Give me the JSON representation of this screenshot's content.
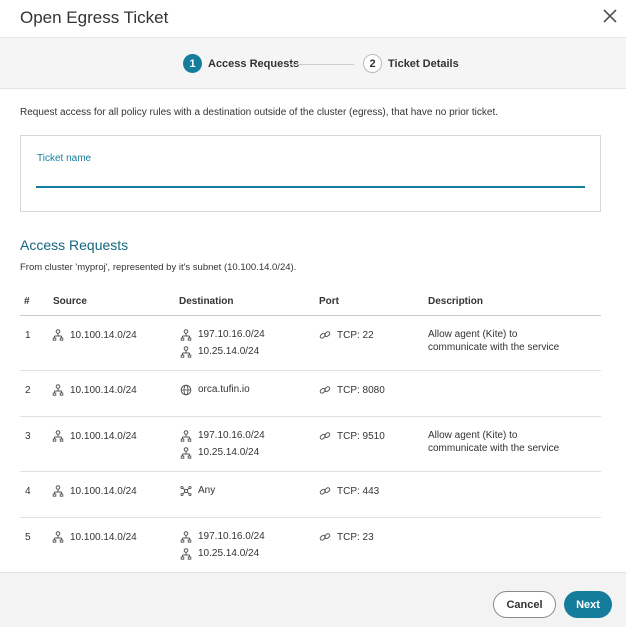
{
  "dialog": {
    "title": "Open Egress Ticket"
  },
  "stepper": {
    "steps": [
      {
        "number": "1",
        "label": "Access Requests",
        "active": true
      },
      {
        "number": "2",
        "label": "Ticket Details",
        "active": false
      }
    ]
  },
  "intro_text": "Request access for all policy rules with a destination outside of the cluster (egress), that have no prior ticket.",
  "ticket": {
    "label": "Ticket name",
    "value": "",
    "placeholder": ""
  },
  "access_requests": {
    "title": "Access Requests",
    "subtitle": "From cluster 'myproj', represented by it's subnet (10.100.14.0/24).",
    "columns": [
      "#",
      "Source",
      "Destination",
      "Port",
      "Description"
    ],
    "rows": [
      {
        "num": "1",
        "source": "10.100.14.0/24",
        "destinations": [
          {
            "icon": "network-node-icon",
            "text": "197.10.16.0/24"
          },
          {
            "icon": "network-node-icon",
            "text": "10.25.14.0/24"
          }
        ],
        "port": "TCP: 22",
        "description": "Allow agent (Kite) to communicate with the service"
      },
      {
        "num": "2",
        "source": "10.100.14.0/24",
        "destinations": [
          {
            "icon": "globe-icon",
            "text": "orca.tufin.io"
          }
        ],
        "port": "TCP: 8080",
        "description": ""
      },
      {
        "num": "3",
        "source": "10.100.14.0/24",
        "destinations": [
          {
            "icon": "network-node-icon",
            "text": "197.10.16.0/24"
          },
          {
            "icon": "network-node-icon",
            "text": "10.25.14.0/24"
          }
        ],
        "port": "TCP: 9510",
        "description": "Allow agent (Kite) to communicate with the service"
      },
      {
        "num": "4",
        "source": "10.100.14.0/24",
        "destinations": [
          {
            "icon": "any-icon",
            "text": "Any"
          }
        ],
        "port": "TCP: 443",
        "description": ""
      },
      {
        "num": "5",
        "source": "10.100.14.0/24",
        "destinations": [
          {
            "icon": "network-node-icon",
            "text": "197.10.16.0/24"
          },
          {
            "icon": "network-node-icon",
            "text": "10.25.14.0/24"
          }
        ],
        "port": "TCP: 23",
        "description": ""
      }
    ]
  },
  "footer": {
    "cancel_label": "Cancel",
    "next_label": "Next"
  },
  "colors": {
    "accent": "#157d9c",
    "section_title": "#13667f",
    "footer_bg": "#f3f3f3"
  }
}
